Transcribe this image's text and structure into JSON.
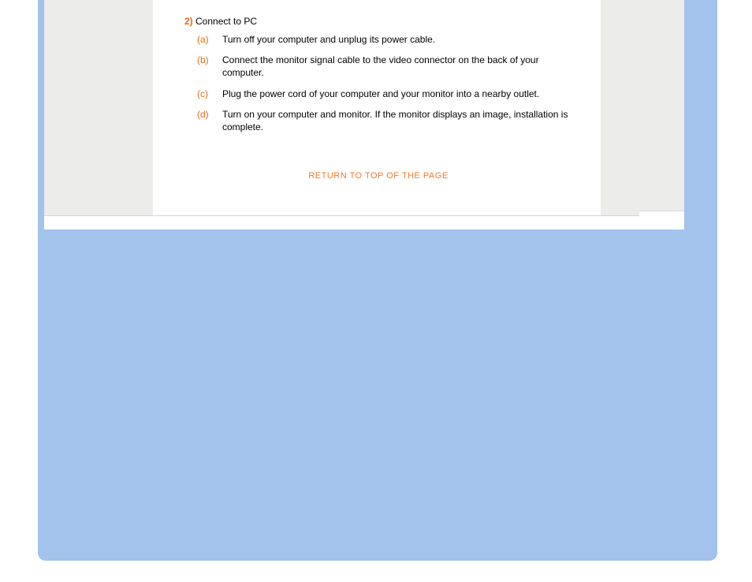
{
  "section": {
    "number": "2)",
    "title": "Connect to PC"
  },
  "steps": [
    {
      "label": "(a)",
      "text": "Turn off your computer and unplug its power cable."
    },
    {
      "label": "(b)",
      "text": "Connect the monitor signal cable to the video connector on the back of your computer."
    },
    {
      "label": "(c)",
      "text": "Plug the power cord of your computer and your monitor into a nearby outlet."
    },
    {
      "label": "(d)",
      "text": "Turn on your computer and monitor. If the monitor displays an image, installation is complete."
    }
  ],
  "links": {
    "return_top": "RETURN TO TOP OF THE PAGE"
  }
}
